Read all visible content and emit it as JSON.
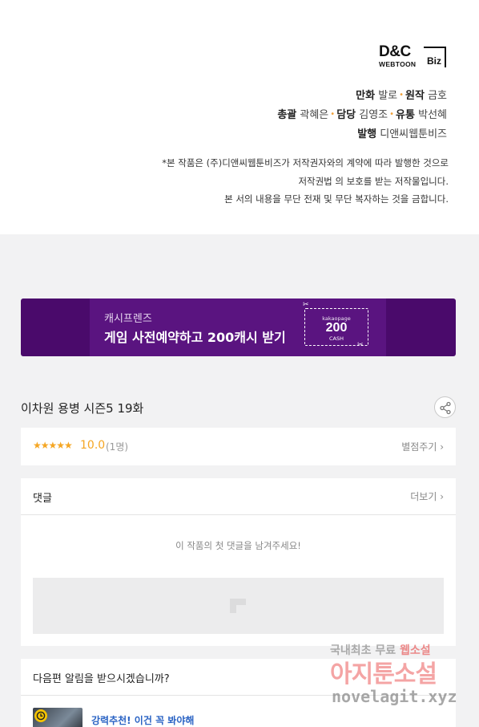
{
  "credits": {
    "logo_top": "D&C",
    "logo_bottom": "WEBTOON",
    "logo_biz": "Biz",
    "line1": {
      "k1": "만화",
      "v1": "발로",
      "k2": "원작",
      "v2": "금호"
    },
    "line2": {
      "k1": "총괄",
      "v1": "곽혜은",
      "k2": "담당",
      "v2": "김영조",
      "k3": "유통",
      "v3": "박선혜"
    },
    "line3": {
      "k1": "발행",
      "v1": "디앤씨웹툰비즈"
    },
    "separator": "•",
    "notice": [
      "*본 작품은 (주)디앤씨웹툰비즈가 저작권자와의 계약에 따라 발행한 것으로",
      "저작권법 의 보호를 받는 저작물입니다.",
      "본 서의 내용을 무단 전재 및 무단 복자하는 것을 금합니다."
    ]
  },
  "banner": {
    "small": "캐시프렌즈",
    "big": "게임 사전예약하고 200캐시 받기",
    "coupon_brand": "kakaopage",
    "coupon_amount": "200",
    "coupon_unit": "CASH",
    "bg_color": "#4a0a6b"
  },
  "episode": {
    "title": "이차원 용병 시즌5 19화"
  },
  "rating": {
    "stars": "★★★★★",
    "score": "10.0",
    "count": "(1명)",
    "rate_link": "별점주기 ›"
  },
  "comments": {
    "header": "댓글",
    "more": "더보기 ›",
    "empty": "이 작품의 첫 댓글을 남겨주세요!"
  },
  "notify": {
    "header": "다음편 알림을 받으시겠습니까?",
    "promo": "강력추천! 이건 꼭 봐야해"
  },
  "watermark": {
    "line1a": "국내최초 무료",
    "line1b": "웹소설",
    "line2": "아지툰소설",
    "line3": "novelagit.xyz"
  },
  "colors": {
    "accent_star": "#f5a623",
    "link_blue": "#2a63c4"
  }
}
